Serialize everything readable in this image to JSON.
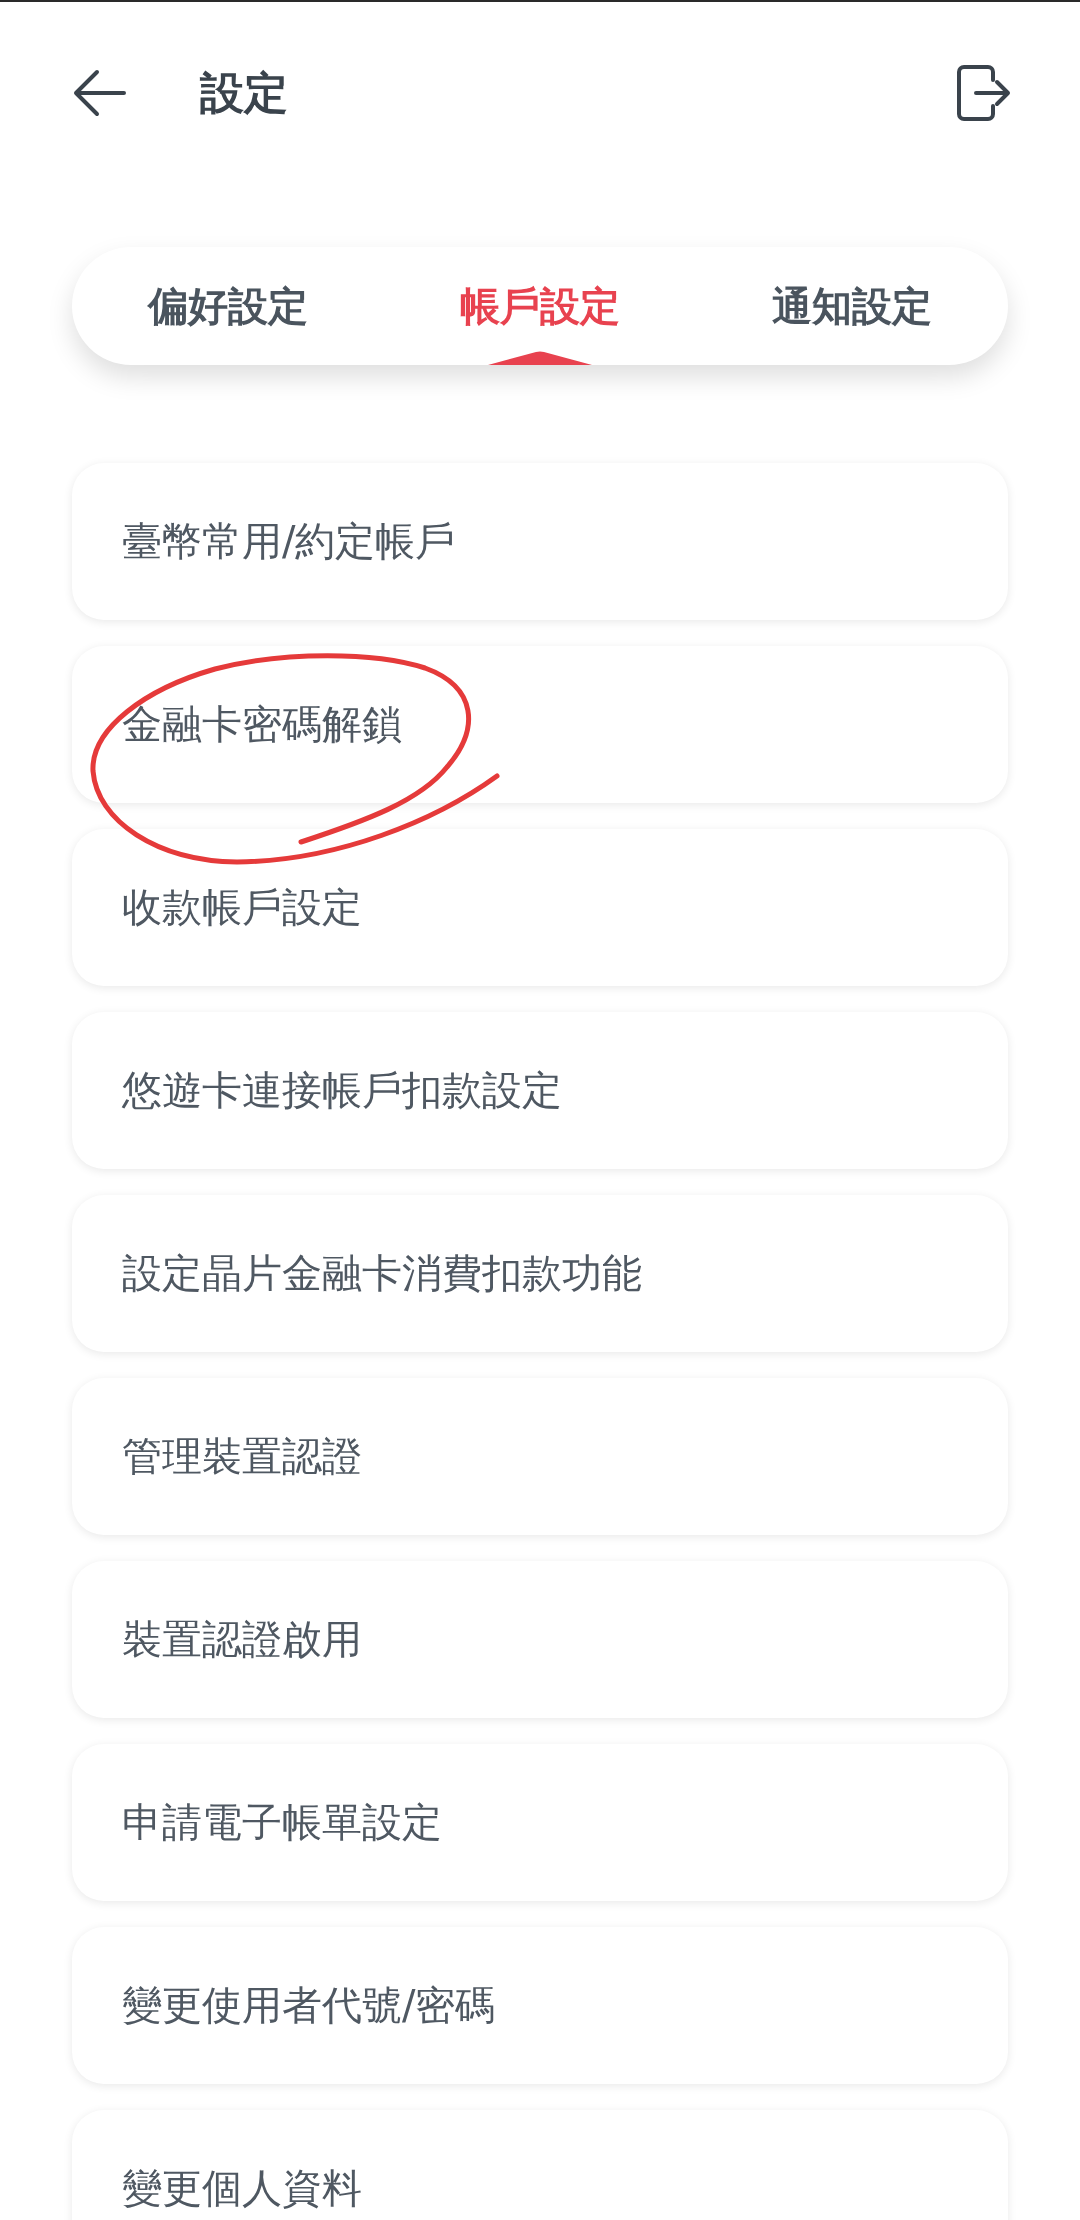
{
  "header": {
    "title": "設定"
  },
  "tabs": [
    {
      "label": "偏好設定",
      "selected": false
    },
    {
      "label": "帳戶設定",
      "selected": true
    },
    {
      "label": "通知設定",
      "selected": false
    }
  ],
  "items": [
    {
      "label": "臺幣常用/約定帳戶",
      "circled": false
    },
    {
      "label": "金融卡密碼解鎖",
      "circled": true
    },
    {
      "label": "收款帳戶設定",
      "circled": false
    },
    {
      "label": "悠遊卡連接帳戶扣款設定",
      "circled": false
    },
    {
      "label": "設定晶片金融卡消費扣款功能",
      "circled": false
    },
    {
      "label": "管理裝置認證",
      "circled": false
    },
    {
      "label": "裝置認證啟用",
      "circled": false
    },
    {
      "label": "申請電子帳單設定",
      "circled": false
    },
    {
      "label": "變更使用者代號/密碼",
      "circled": false
    },
    {
      "label": "變更個人資料",
      "circled": false
    }
  ]
}
